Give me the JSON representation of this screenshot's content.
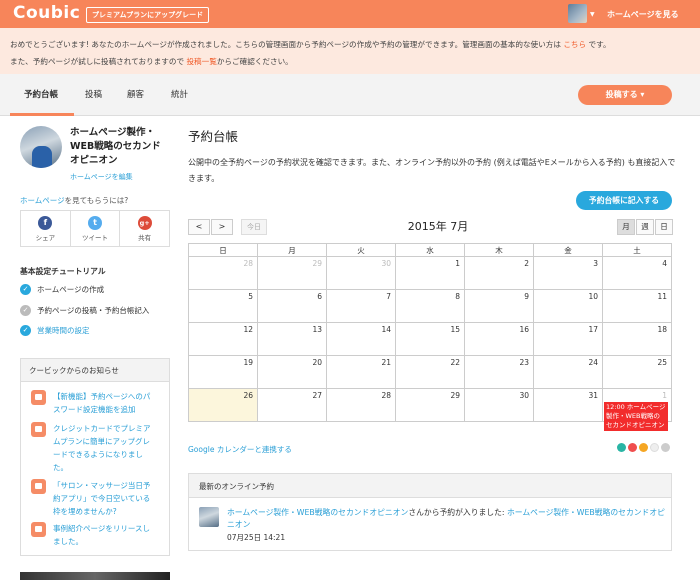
{
  "header": {
    "logo": "Coubic",
    "upgrade_label": "プレミアムプランにアップグレード",
    "view_home": "ホームページを見る"
  },
  "notice": {
    "line1_a": "おめでとうございます! あなたのホームページが作成されました。こちらの管理画面から予約ページの作成や予約の管理ができます。管理画面の基本的な使い方は",
    "line1_link": "こちら",
    "line1_b": "です。",
    "line2_a": "また、予約ページが試しに投稿されておりますので",
    "line2_link": "投稿一覧",
    "line2_b": "からご確認ください。"
  },
  "tabs": [
    "予約台帳",
    "投稿",
    "顧客",
    "統計"
  ],
  "post_button": "投稿する ▾",
  "sidebar": {
    "site_name": "ホームページ製作・WEB戦略のセカンドオピニオン",
    "edit_link": "ホームページを編集",
    "share_question_link": "ホームページ",
    "share_question_rest": "を見てもらうには?",
    "share": [
      {
        "icon": "f",
        "label": "シェア",
        "color": "#3b5998"
      },
      {
        "icon": "t",
        "label": "ツイート",
        "color": "#55acee"
      },
      {
        "icon": "g+",
        "label": "共有",
        "color": "#dd4b39"
      }
    ],
    "tutorial_title": "基本設定チュートリアル",
    "tutorial": [
      {
        "label": "ホームページの作成",
        "done": true
      },
      {
        "label": "予約ページの投稿・予約台帳記入",
        "done": false
      },
      {
        "label": "営業時間の設定",
        "done": true
      }
    ],
    "news_title": "クービックからのお知らせ",
    "news": [
      "【新機能】予約ページへのパスワード設定機能を追加",
      "クレジットカードでプレミアムプランに簡単にアップグレードできるようになりました。",
      "「サロン・マッサージ当日予約アプリ」で今日空いている枠を埋めませんか?",
      "事例紹介ページをリリースしました。"
    ]
  },
  "main": {
    "title": "予約台帳",
    "description": "公開中の全予約ページの予約状況を確認できます。また、オンライン予約以外の予約 (例えば電話やEメールから入る予約) も直接記入できます。",
    "add_button": "予約台帳に記入する",
    "prev": "<",
    "next": ">",
    "today": "今日",
    "month_title": "2015年 7月",
    "views": [
      "月",
      "週",
      "日"
    ],
    "weekdays": [
      "日",
      "月",
      "火",
      "水",
      "木",
      "金",
      "土"
    ],
    "weeks": [
      [
        "28",
        "29",
        "30",
        "1",
        "2",
        "3",
        "4"
      ],
      [
        "5",
        "6",
        "7",
        "8",
        "9",
        "10",
        "11"
      ],
      [
        "12",
        "13",
        "14",
        "15",
        "16",
        "17",
        "18"
      ],
      [
        "19",
        "20",
        "21",
        "22",
        "23",
        "24",
        "25"
      ],
      [
        "26",
        "27",
        "28",
        "29",
        "30",
        "31",
        "1"
      ]
    ],
    "event_text": "12:00 ホームページ製作・WEB戦略のセカンドオピニオン",
    "gcal_link": "Google カレンダーと連携する",
    "dot_colors": [
      "#2ab5a5",
      "#f04e4e",
      "#f5a623",
      "#eeeeee",
      "#cccccc"
    ],
    "online_title": "最新のオンライン予約",
    "online_link1": "ホームページ製作・WEB戦略のセカンドオピニオン",
    "online_mid": "さんから予約が入りました: ",
    "online_link2": "ホームページ製作・WEB戦略のセカンドオピニオン",
    "online_date": "07月25日 14:21"
  }
}
